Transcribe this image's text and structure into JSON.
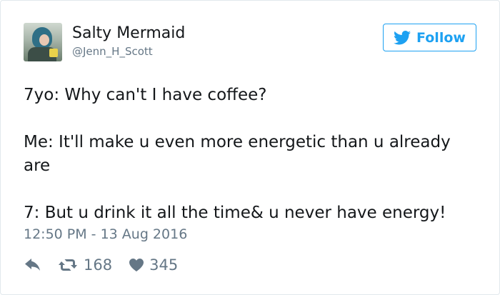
{
  "author": {
    "name": "Salty Mermaid",
    "handle": "@Jenn_H_Scott",
    "avatar_icon": "user-photo-avatar"
  },
  "follow_button": {
    "label": "Follow",
    "icon": "twitter-bird-icon",
    "color": "#1da1f2"
  },
  "tweet": {
    "lines": [
      "7yo: Why can't I have coffee?",
      "Me: It'll make u even more energetic than u already are",
      "7: But u drink it all the time& u never have energy!"
    ],
    "timestamp": "12:50 PM - 13 Aug 2016"
  },
  "actions": {
    "reply_icon": "reply-arrow-icon",
    "retweet_icon": "retweet-icon",
    "retweet_count": "168",
    "like_icon": "heart-icon",
    "like_count": "345"
  },
  "colors": {
    "text_primary": "#14171a",
    "text_secondary": "#657786",
    "accent": "#1da1f2",
    "border": "#e1e8ed"
  }
}
